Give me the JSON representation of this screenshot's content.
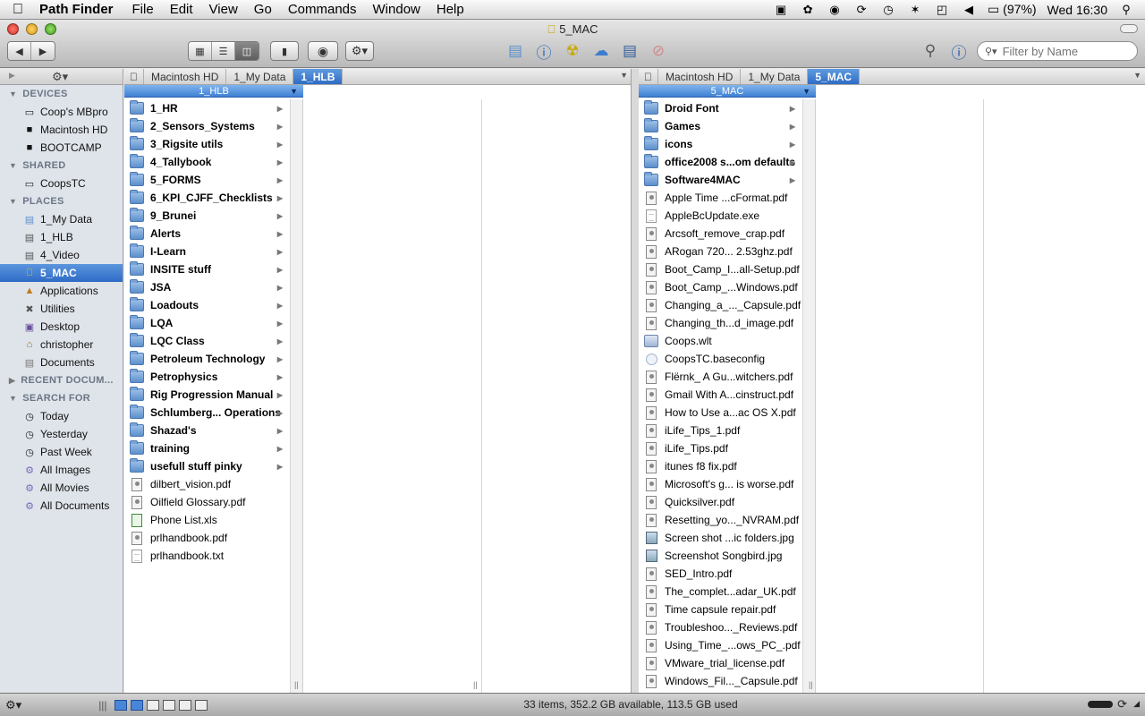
{
  "menubar": {
    "app_name": "Path Finder",
    "items": [
      "File",
      "Edit",
      "View",
      "Go",
      "Commands",
      "Window",
      "Help"
    ],
    "battery": "(97%)",
    "clock": "Wed 16:30"
  },
  "window": {
    "title": "5_MAC",
    "search_placeholder": "Filter by Name"
  },
  "sidebar": {
    "sections": [
      {
        "title": "DEVICES",
        "items": [
          {
            "label": "Coop's MBpro",
            "icon": "laptop-icon"
          },
          {
            "label": "Macintosh HD",
            "icon": "hard-drive-icon"
          },
          {
            "label": "BOOTCAMP",
            "icon": "hard-drive-icon"
          }
        ]
      },
      {
        "title": "SHARED",
        "items": [
          {
            "label": "CoopsTC",
            "icon": "network-computer-icon"
          }
        ]
      },
      {
        "title": "PLACES",
        "items": [
          {
            "label": "1_My Data",
            "icon": "folder-icon"
          },
          {
            "label": "1_HLB",
            "icon": "folder-icon"
          },
          {
            "label": "4_Video",
            "icon": "folder-icon"
          },
          {
            "label": "5_MAC",
            "icon": "apple-folder-icon",
            "selected": true
          },
          {
            "label": "Applications",
            "icon": "applications-icon"
          },
          {
            "label": "Utilities",
            "icon": "utilities-icon"
          },
          {
            "label": "Desktop",
            "icon": "desktop-icon"
          },
          {
            "label": "christopher",
            "icon": "home-icon"
          },
          {
            "label": "Documents",
            "icon": "documents-icon"
          }
        ]
      },
      {
        "title": "RECENT DOCUM...",
        "collapsed": true,
        "items": []
      },
      {
        "title": "SEARCH FOR",
        "items": [
          {
            "label": "Today",
            "icon": "clock-icon"
          },
          {
            "label": "Yesterday",
            "icon": "clock-icon"
          },
          {
            "label": "Past Week",
            "icon": "clock-icon"
          },
          {
            "label": "All Images",
            "icon": "smart-folder-icon"
          },
          {
            "label": "All Movies",
            "icon": "smart-folder-icon"
          },
          {
            "label": "All Documents",
            "icon": "smart-folder-icon"
          }
        ]
      }
    ]
  },
  "left_pane": {
    "path": [
      "Macintosh HD",
      "1_My Data",
      "1_HLB"
    ],
    "column_header": "1_HLB",
    "items": [
      {
        "name": "1_HR",
        "type": "folder"
      },
      {
        "name": "2_Sensors_Systems",
        "type": "folder"
      },
      {
        "name": "3_Rigsite utils",
        "type": "folder"
      },
      {
        "name": "4_Tallybook",
        "type": "folder"
      },
      {
        "name": "5_FORMS",
        "type": "folder"
      },
      {
        "name": "6_KPI_CJFF_Checklists",
        "type": "folder"
      },
      {
        "name": "9_Brunei",
        "type": "folder"
      },
      {
        "name": "Alerts",
        "type": "folder"
      },
      {
        "name": "I-Learn",
        "type": "folder"
      },
      {
        "name": "INSITE stuff",
        "type": "folder"
      },
      {
        "name": "JSA",
        "type": "folder"
      },
      {
        "name": "Loadouts",
        "type": "folder"
      },
      {
        "name": "LQA",
        "type": "folder"
      },
      {
        "name": "LQC Class",
        "type": "folder"
      },
      {
        "name": "Petroleum Technology",
        "type": "folder"
      },
      {
        "name": "Petrophysics",
        "type": "folder"
      },
      {
        "name": "Rig Progression Manual",
        "type": "folder"
      },
      {
        "name": "Schlumberg... Operations",
        "type": "folder"
      },
      {
        "name": "Shazad's",
        "type": "folder"
      },
      {
        "name": "training",
        "type": "folder"
      },
      {
        "name": "usefull stuff pinky",
        "type": "folder"
      },
      {
        "name": "dilbert_vision.pdf",
        "type": "pdf"
      },
      {
        "name": "Oilfield Glossary.pdf",
        "type": "pdf"
      },
      {
        "name": "Phone List.xls",
        "type": "xls"
      },
      {
        "name": "prlhandbook.pdf",
        "type": "pdf"
      },
      {
        "name": "prlhandbook.txt",
        "type": "doc"
      }
    ]
  },
  "right_pane": {
    "path": [
      "Macintosh HD",
      "1_My Data",
      "5_MAC"
    ],
    "column_header": "5_MAC",
    "items": [
      {
        "name": "Droid Font",
        "type": "folder"
      },
      {
        "name": "Games",
        "type": "folder"
      },
      {
        "name": "icons",
        "type": "folder"
      },
      {
        "name": "office2008 s...om defaults",
        "type": "folder"
      },
      {
        "name": "Software4MAC",
        "type": "folder"
      },
      {
        "name": "Apple Time ...cFormat.pdf",
        "type": "pdf"
      },
      {
        "name": "AppleBcUpdate.exe",
        "type": "doc"
      },
      {
        "name": "Arcsoft_remove_crap.pdf",
        "type": "pdf"
      },
      {
        "name": "ARogan 720... 2.53ghz.pdf",
        "type": "pdf"
      },
      {
        "name": "Boot_Camp_I...all-Setup.pdf",
        "type": "pdf"
      },
      {
        "name": "Boot_Camp_...Windows.pdf",
        "type": "pdf"
      },
      {
        "name": "Changing_a_..._Capsule.pdf",
        "type": "pdf"
      },
      {
        "name": "Changing_th...d_image.pdf",
        "type": "pdf"
      },
      {
        "name": "Coops.wlt",
        "type": "wlt"
      },
      {
        "name": "CoopsTC.baseconfig",
        "type": "cfg"
      },
      {
        "name": "Flërnk_ A Gu...witchers.pdf",
        "type": "pdf"
      },
      {
        "name": "Gmail With A...cinstruct.pdf",
        "type": "pdf"
      },
      {
        "name": "How to Use a...ac OS X.pdf",
        "type": "pdf"
      },
      {
        "name": "iLife_Tips_1.pdf",
        "type": "pdf"
      },
      {
        "name": "iLife_Tips.pdf",
        "type": "pdf"
      },
      {
        "name": "itunes f8 fix.pdf",
        "type": "pdf"
      },
      {
        "name": "Microsoft's g... is worse.pdf",
        "type": "pdf"
      },
      {
        "name": "Quicksilver.pdf",
        "type": "pdf"
      },
      {
        "name": "Resetting_yo..._NVRAM.pdf",
        "type": "pdf"
      },
      {
        "name": "Screen shot ...ic folders.jpg",
        "type": "img"
      },
      {
        "name": "Screenshot Songbird.jpg",
        "type": "img"
      },
      {
        "name": "SED_Intro.pdf",
        "type": "pdf"
      },
      {
        "name": "The_complet...adar_UK.pdf",
        "type": "pdf"
      },
      {
        "name": "Time capsule repair.pdf",
        "type": "pdf"
      },
      {
        "name": "Troubleshoo..._Reviews.pdf",
        "type": "pdf"
      },
      {
        "name": "Using_Time_...ows_PC_.pdf",
        "type": "pdf"
      },
      {
        "name": "VMware_trial_license.pdf",
        "type": "pdf"
      },
      {
        "name": "Windows_Fil..._Capsule.pdf",
        "type": "pdf"
      }
    ]
  },
  "statusbar": {
    "text": "33 items, 352.2 GB available, 113.5 GB used"
  }
}
